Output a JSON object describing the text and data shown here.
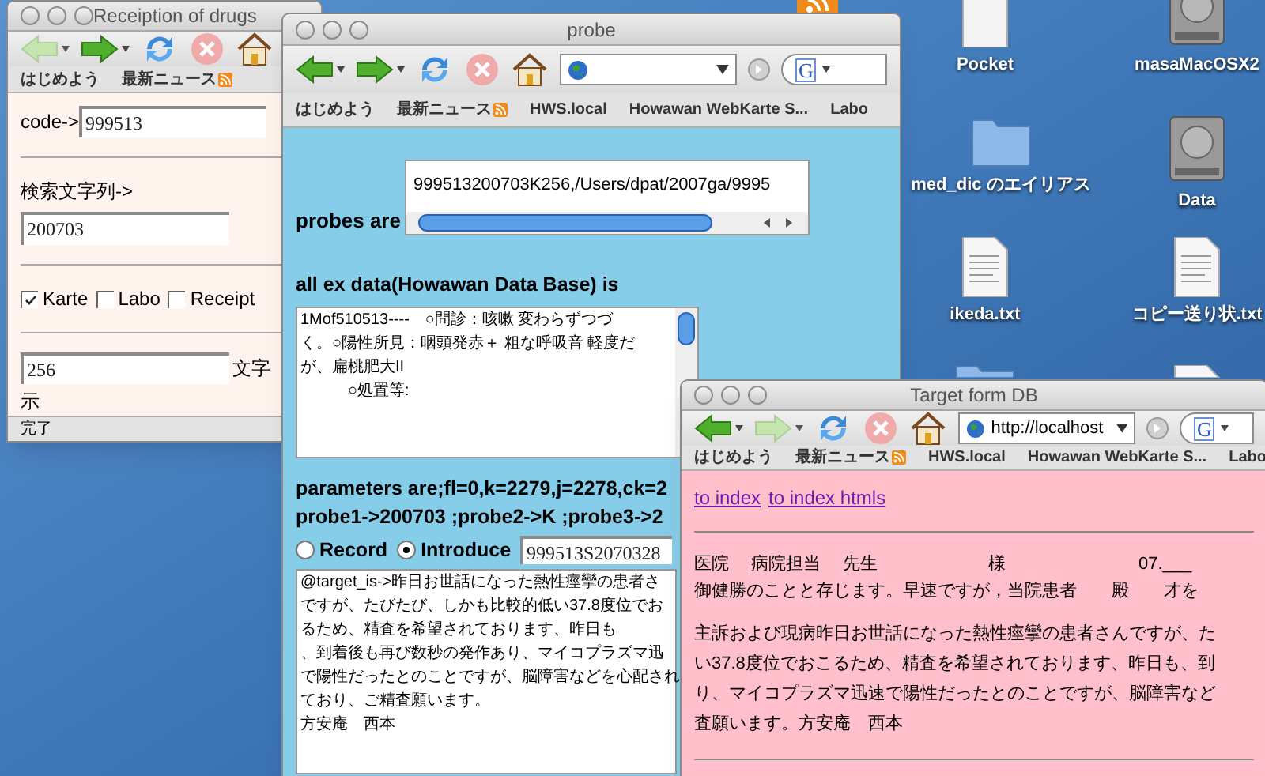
{
  "desktop": {
    "icons": [
      {
        "kind": "feed"
      },
      {
        "kind": "document",
        "label": "Pocket"
      },
      {
        "kind": "disk",
        "label": "masaMacOSX2"
      },
      {
        "kind": "folder",
        "label": "med_dic のエイリアス"
      },
      {
        "kind": "disk",
        "label": "Data"
      },
      {
        "kind": "text",
        "label": "ikeda.txt"
      },
      {
        "kind": "text",
        "label": "コピー送り状.txt"
      },
      {
        "kind": "folder"
      },
      {
        "kind": "text"
      }
    ]
  },
  "drugs_window": {
    "title": "Receiption of drugs",
    "nav_buttons": [
      {
        "kind": "back",
        "disabled": true
      },
      {
        "kind": "forward",
        "disabled": false
      },
      {
        "kind": "reload",
        "disabled": false
      },
      {
        "kind": "stop",
        "disabled": true
      },
      {
        "kind": "home",
        "disabled": false
      }
    ],
    "bookmarks": [
      {
        "label": "はじめよう",
        "feed": false
      },
      {
        "label": "最新ニュース",
        "feed": true
      }
    ],
    "code_label": "code->",
    "code_value": "999513",
    "search_label": "検索文字列->",
    "search_value": "200703",
    "checkboxes": [
      {
        "label": "Karte",
        "checked": true
      },
      {
        "label": "Labo",
        "checked": false
      },
      {
        "label": "Receipt",
        "checked": false
      }
    ],
    "length_value": "256",
    "length_suffix": "文字",
    "length_suffix_2": "示",
    "status": "完了"
  },
  "probe_window": {
    "title": "probe",
    "nav_buttons": [
      {
        "kind": "back",
        "disabled": false
      },
      {
        "kind": "forward",
        "disabled": false
      },
      {
        "kind": "reload",
        "disabled": false
      },
      {
        "kind": "stop",
        "disabled": true
      },
      {
        "kind": "home",
        "disabled": false
      }
    ],
    "address_field": {
      "shown": true
    },
    "search_field": {
      "engine_mark": "G"
    },
    "bookmarks": [
      {
        "label": "はじめよう",
        "feed": false
      },
      {
        "label": "最新ニュース",
        "feed": true
      },
      {
        "label": "HWS.local",
        "feed": false
      },
      {
        "label": "Howawan WebKarte S...",
        "feed": false
      },
      {
        "label": "Labo",
        "feed": false
      }
    ],
    "probes_label": "probes are",
    "probes_value": "999513200703K256,/Users/dpat/2007ga/9995",
    "exdata_label": "all ex data(Howawan Data Base) is",
    "exdata_lines": [
      "1Mof510513----　○問診：咳嗽 変わらずつづ",
      "く。○陽性所見：咽頭発赤＋ 粗な呼吸音 軽度だ",
      "が、扁桃肥大II",
      "　　　○処置等:"
    ],
    "parameters_lines": [
      "parameters are;fl=0,k=2279,j=2278,ck=2",
      "probe1->200703 ;probe2->K ;probe3->2"
    ],
    "modes": [
      {
        "label": "Record",
        "selected": false
      },
      {
        "label": "Introduce",
        "selected": true
      }
    ],
    "mode_value": "999513S2070328",
    "target_lines": [
      "@target_is->昨日お世話になった熱性痙攣の患者さ",
      "ですが、たびたび、しかも比較的低い37.8度位でお",
      "るため、精査を希望されております、昨日も",
      "、到着後も再び数秒の発作あり、マイコプラズマ迅",
      "で陽性だったとのことですが、脳障害などを心配され",
      "ており、ご精査願います。",
      "方安庵　西本"
    ]
  },
  "target_window": {
    "title": "Target form DB",
    "nav_buttons": [
      {
        "kind": "back",
        "disabled": false
      },
      {
        "kind": "forward",
        "disabled": true
      },
      {
        "kind": "reload",
        "disabled": false
      },
      {
        "kind": "stop",
        "disabled": true
      },
      {
        "kind": "home",
        "disabled": false
      }
    ],
    "address_field": {
      "shown": true,
      "value": "http://localhost"
    },
    "search_field": {
      "engine_mark": "G"
    },
    "bookmarks": [
      {
        "label": "はじめよう",
        "feed": false
      },
      {
        "label": "最新ニュース",
        "feed": true
      },
      {
        "label": "HWS.local",
        "feed": false
      },
      {
        "label": "Howawan WebKarte S...",
        "feed": false
      },
      {
        "label": "Labo",
        "feed": false
      }
    ],
    "links": [
      "to index",
      "to index htmls"
    ],
    "header_parts": [
      "医院",
      "病院担当",
      "先生",
      "様",
      "07.___"
    ],
    "greeting": "御健勝のことと存じます。早速ですが，当院患者　　殿　　才を",
    "body_lines": [
      "主訴および現病昨日お世話になった熱性痙攣の患者さんですが、た",
      "い37.8度位でおこるため、精査を希望されております、昨日も、到",
      "り、マイコプラズマ迅速で陽性だったとのことですが、脳障害など",
      "査願います。方安庵　西本"
    ]
  }
}
